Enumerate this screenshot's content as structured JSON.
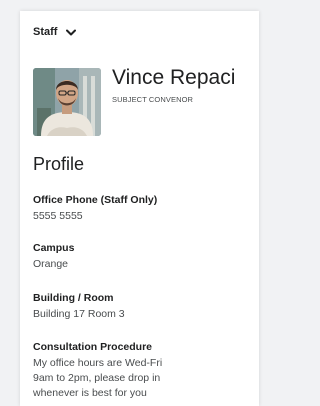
{
  "dropdown": {
    "label": "Staff",
    "icon": "chevron-down-icon"
  },
  "profile": {
    "name": "Vince Repaci",
    "role": "SUBJECT CONVENOR",
    "heading": "Profile"
  },
  "fields": [
    {
      "label": "Office Phone (Staff Only)",
      "value": "5555 5555"
    },
    {
      "label": "Campus",
      "value": "Orange"
    },
    {
      "label": "Building / Room",
      "value": "Building 17 Room 3"
    },
    {
      "label": "Consultation Procedure",
      "value": "My office hours are Wed-Fri 9am to 2pm, please drop in whenever is best for you"
    }
  ]
}
